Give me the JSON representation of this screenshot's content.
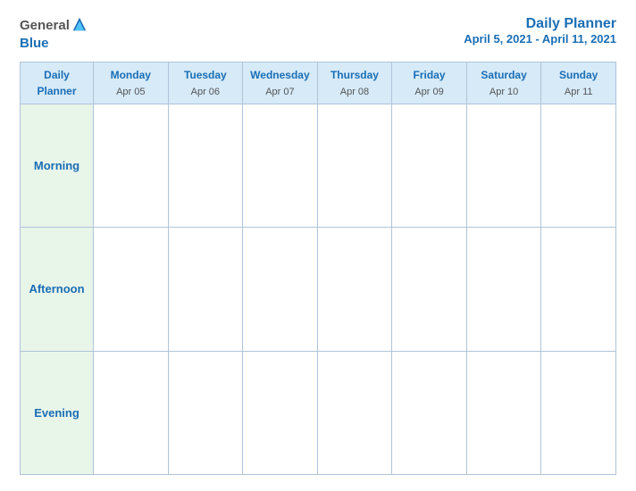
{
  "header": {
    "logo": {
      "general": "General",
      "blue": "Blue"
    },
    "title": "Daily Planner",
    "subtitle": "April 5, 2021 - April 11, 2021"
  },
  "table": {
    "label_header_line1": "Daily",
    "label_header_line2": "Planner",
    "columns": [
      {
        "day": "Monday",
        "date": "Apr 05"
      },
      {
        "day": "Tuesday",
        "date": "Apr 06"
      },
      {
        "day": "Wednesday",
        "date": "Apr 07"
      },
      {
        "day": "Thursday",
        "date": "Apr 08"
      },
      {
        "day": "Friday",
        "date": "Apr 09"
      },
      {
        "day": "Saturday",
        "date": "Apr 10"
      },
      {
        "day": "Sunday",
        "date": "Apr 11"
      }
    ],
    "rows": [
      {
        "label": "Morning"
      },
      {
        "label": "Afternoon"
      },
      {
        "label": "Evening"
      }
    ]
  }
}
